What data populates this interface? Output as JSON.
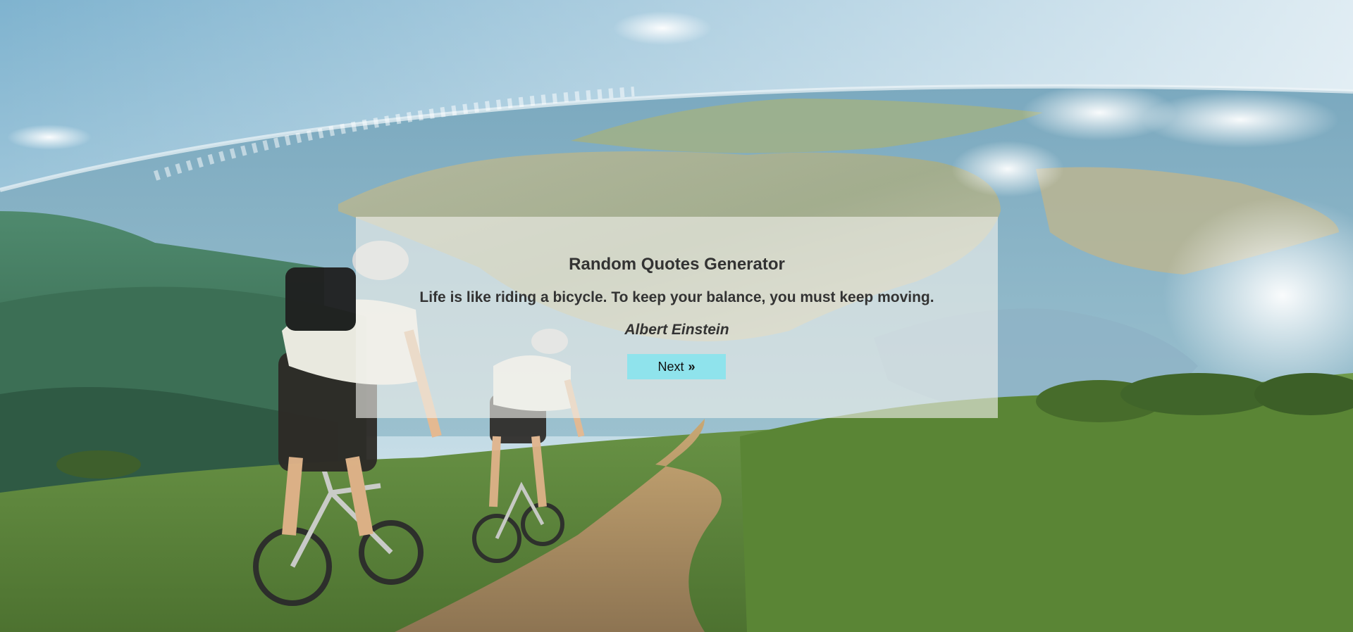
{
  "quote_card": {
    "title": "Random Quotes Generator",
    "quote": "Life is like riding a bicycle. To keep your balance, you must keep moving.",
    "author": "Albert Einstein",
    "next_label": "Next",
    "next_icon": "double-chevron-right-icon",
    "next_icon_glyph": "»"
  },
  "colors": {
    "button_bg": "#8fe3ec",
    "text": "#333333",
    "card_bg": "rgba(240,240,236,0.62)"
  }
}
